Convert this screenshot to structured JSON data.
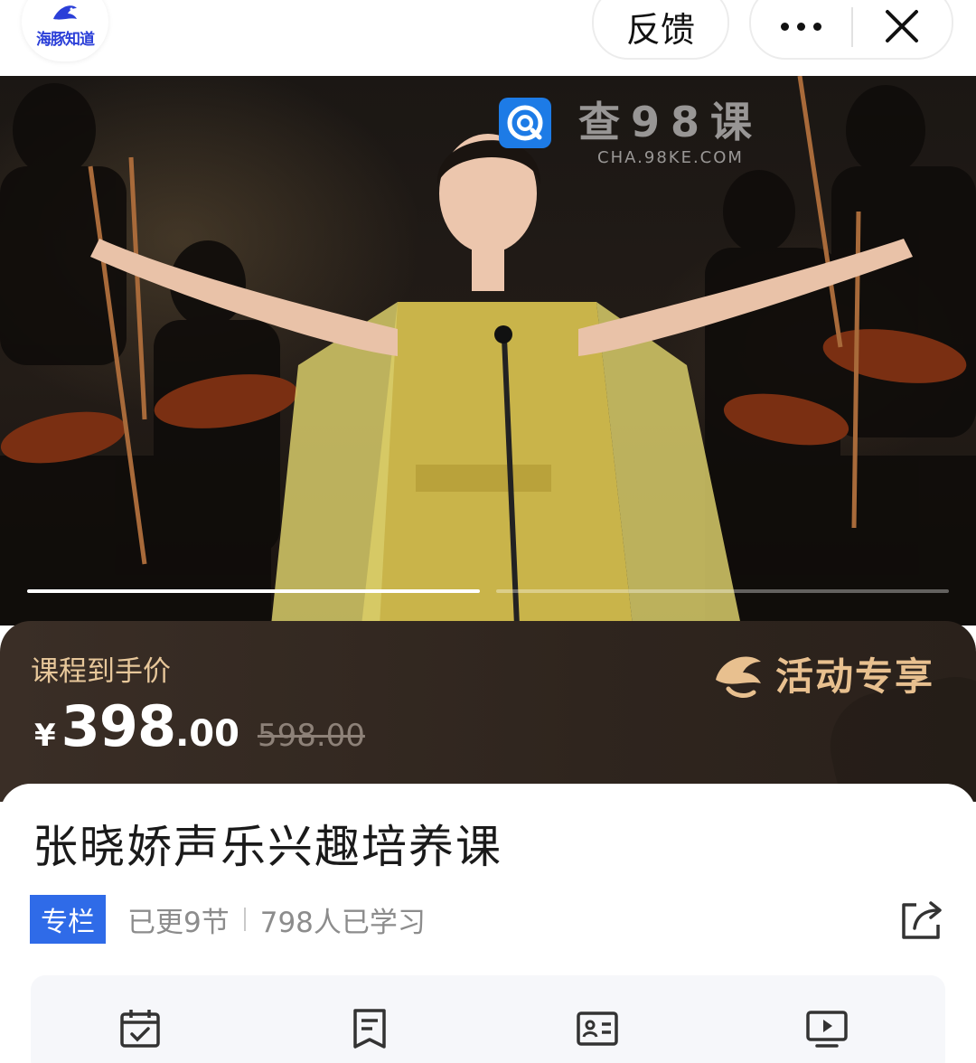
{
  "app": {
    "logo_text": "海豚知道",
    "brand_color": "#2b3fd8"
  },
  "header": {
    "feedback_label": "反馈",
    "more_icon": "more-dots-icon",
    "close_icon": "close-icon"
  },
  "hero": {
    "image_subject": "singer-on-stage",
    "watermark": {
      "title": "查98课",
      "subtitle": "CHA.98KE.COM"
    },
    "carousel": {
      "slides": 2,
      "active_index": 0
    }
  },
  "price": {
    "label": "课程到手价",
    "currency": "¥",
    "current_int": "398",
    "current_dec": ".00",
    "original": "598.00",
    "promo": "活动专享",
    "accent_color": "#e7c79a"
  },
  "course": {
    "title": "张晓娇声乐兴趣培养课",
    "tag": "专栏",
    "tag_color": "#2f6be8",
    "updates": "已更9节",
    "learners": "798人已学习",
    "share_icon": "share-icon"
  },
  "toolbar": {
    "icons": [
      "calendar-check-icon",
      "notes-icon",
      "id-card-icon",
      "video-play-icon"
    ]
  }
}
